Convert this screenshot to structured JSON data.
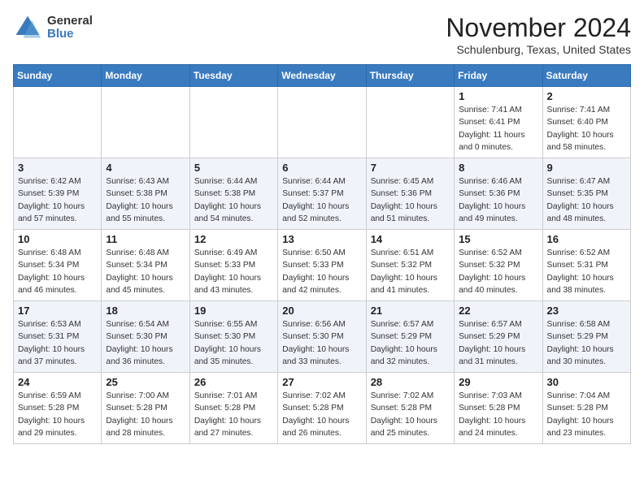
{
  "header": {
    "logo_general": "General",
    "logo_blue": "Blue",
    "month_title": "November 2024",
    "location": "Schulenburg, Texas, United States"
  },
  "days_of_week": [
    "Sunday",
    "Monday",
    "Tuesday",
    "Wednesday",
    "Thursday",
    "Friday",
    "Saturday"
  ],
  "weeks": [
    [
      {
        "day": "",
        "info": ""
      },
      {
        "day": "",
        "info": ""
      },
      {
        "day": "",
        "info": ""
      },
      {
        "day": "",
        "info": ""
      },
      {
        "day": "",
        "info": ""
      },
      {
        "day": "1",
        "info": "Sunrise: 7:41 AM\nSunset: 6:41 PM\nDaylight: 11 hours\nand 0 minutes."
      },
      {
        "day": "2",
        "info": "Sunrise: 7:41 AM\nSunset: 6:40 PM\nDaylight: 10 hours\nand 58 minutes."
      }
    ],
    [
      {
        "day": "3",
        "info": "Sunrise: 6:42 AM\nSunset: 5:39 PM\nDaylight: 10 hours\nand 57 minutes."
      },
      {
        "day": "4",
        "info": "Sunrise: 6:43 AM\nSunset: 5:38 PM\nDaylight: 10 hours\nand 55 minutes."
      },
      {
        "day": "5",
        "info": "Sunrise: 6:44 AM\nSunset: 5:38 PM\nDaylight: 10 hours\nand 54 minutes."
      },
      {
        "day": "6",
        "info": "Sunrise: 6:44 AM\nSunset: 5:37 PM\nDaylight: 10 hours\nand 52 minutes."
      },
      {
        "day": "7",
        "info": "Sunrise: 6:45 AM\nSunset: 5:36 PM\nDaylight: 10 hours\nand 51 minutes."
      },
      {
        "day": "8",
        "info": "Sunrise: 6:46 AM\nSunset: 5:36 PM\nDaylight: 10 hours\nand 49 minutes."
      },
      {
        "day": "9",
        "info": "Sunrise: 6:47 AM\nSunset: 5:35 PM\nDaylight: 10 hours\nand 48 minutes."
      }
    ],
    [
      {
        "day": "10",
        "info": "Sunrise: 6:48 AM\nSunset: 5:34 PM\nDaylight: 10 hours\nand 46 minutes."
      },
      {
        "day": "11",
        "info": "Sunrise: 6:48 AM\nSunset: 5:34 PM\nDaylight: 10 hours\nand 45 minutes."
      },
      {
        "day": "12",
        "info": "Sunrise: 6:49 AM\nSunset: 5:33 PM\nDaylight: 10 hours\nand 43 minutes."
      },
      {
        "day": "13",
        "info": "Sunrise: 6:50 AM\nSunset: 5:33 PM\nDaylight: 10 hours\nand 42 minutes."
      },
      {
        "day": "14",
        "info": "Sunrise: 6:51 AM\nSunset: 5:32 PM\nDaylight: 10 hours\nand 41 minutes."
      },
      {
        "day": "15",
        "info": "Sunrise: 6:52 AM\nSunset: 5:32 PM\nDaylight: 10 hours\nand 40 minutes."
      },
      {
        "day": "16",
        "info": "Sunrise: 6:52 AM\nSunset: 5:31 PM\nDaylight: 10 hours\nand 38 minutes."
      }
    ],
    [
      {
        "day": "17",
        "info": "Sunrise: 6:53 AM\nSunset: 5:31 PM\nDaylight: 10 hours\nand 37 minutes."
      },
      {
        "day": "18",
        "info": "Sunrise: 6:54 AM\nSunset: 5:30 PM\nDaylight: 10 hours\nand 36 minutes."
      },
      {
        "day": "19",
        "info": "Sunrise: 6:55 AM\nSunset: 5:30 PM\nDaylight: 10 hours\nand 35 minutes."
      },
      {
        "day": "20",
        "info": "Sunrise: 6:56 AM\nSunset: 5:30 PM\nDaylight: 10 hours\nand 33 minutes."
      },
      {
        "day": "21",
        "info": "Sunrise: 6:57 AM\nSunset: 5:29 PM\nDaylight: 10 hours\nand 32 minutes."
      },
      {
        "day": "22",
        "info": "Sunrise: 6:57 AM\nSunset: 5:29 PM\nDaylight: 10 hours\nand 31 minutes."
      },
      {
        "day": "23",
        "info": "Sunrise: 6:58 AM\nSunset: 5:29 PM\nDaylight: 10 hours\nand 30 minutes."
      }
    ],
    [
      {
        "day": "24",
        "info": "Sunrise: 6:59 AM\nSunset: 5:28 PM\nDaylight: 10 hours\nand 29 minutes."
      },
      {
        "day": "25",
        "info": "Sunrise: 7:00 AM\nSunset: 5:28 PM\nDaylight: 10 hours\nand 28 minutes."
      },
      {
        "day": "26",
        "info": "Sunrise: 7:01 AM\nSunset: 5:28 PM\nDaylight: 10 hours\nand 27 minutes."
      },
      {
        "day": "27",
        "info": "Sunrise: 7:02 AM\nSunset: 5:28 PM\nDaylight: 10 hours\nand 26 minutes."
      },
      {
        "day": "28",
        "info": "Sunrise: 7:02 AM\nSunset: 5:28 PM\nDaylight: 10 hours\nand 25 minutes."
      },
      {
        "day": "29",
        "info": "Sunrise: 7:03 AM\nSunset: 5:28 PM\nDaylight: 10 hours\nand 24 minutes."
      },
      {
        "day": "30",
        "info": "Sunrise: 7:04 AM\nSunset: 5:28 PM\nDaylight: 10 hours\nand 23 minutes."
      }
    ]
  ]
}
